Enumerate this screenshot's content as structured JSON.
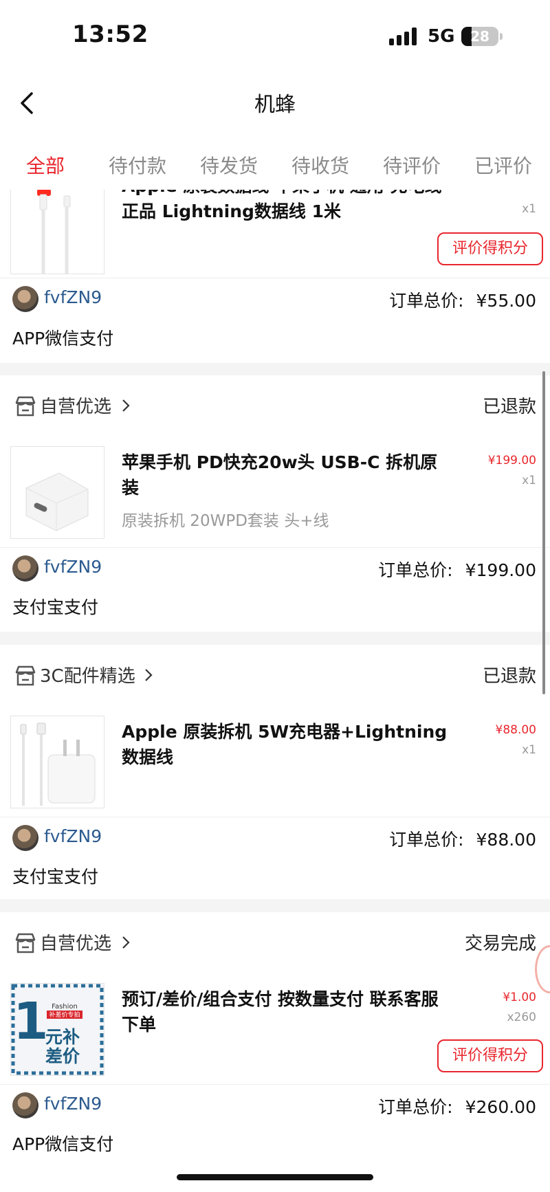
{
  "status_bar": {
    "time": "13:52",
    "network": "5G",
    "battery": "28",
    "battery_level": 0.28
  },
  "nav": {
    "title": "机蜂"
  },
  "tabs": [
    {
      "label": "全部",
      "active": true
    },
    {
      "label": "待付款"
    },
    {
      "label": "待发货"
    },
    {
      "label": "待收货"
    },
    {
      "label": "待评价"
    },
    {
      "label": "已评价"
    }
  ],
  "orders": [
    {
      "title_line1": "Apple 原装数据线 苹果手机 通用 充电线",
      "title_line2": "正品 Lightning数据线 1米",
      "qty": "x1",
      "review_label": "评价得积分",
      "user": "fvfZN9",
      "total_label": "订单总价:",
      "total": "¥55.00",
      "payment": "APP微信支付"
    },
    {
      "shop": "自营优选",
      "status": "已退款",
      "title": "苹果手机 PD快充20w头 USB-C 拆机原装",
      "spec": "原装拆机 20WPD套装 头+线",
      "price": "¥199.00",
      "qty": "x1",
      "user": "fvfZN9",
      "total_label": "订单总价:",
      "total": "¥199.00",
      "payment": "支付宝支付"
    },
    {
      "shop": "3C配件精选",
      "status": "已退款",
      "title": "Apple 原装拆机 5W充电器+Lightning数据线",
      "price": "¥88.00",
      "qty": "x1",
      "user": "fvfZN9",
      "total_label": "订单总价:",
      "total": "¥88.00",
      "payment": "支付宝支付"
    },
    {
      "shop": "自营优选",
      "status": "交易完成",
      "title": "预订/差价/组合支付 按数量支付 联系客服下单",
      "price": "¥1.00",
      "qty": "x260",
      "review_label": "评价得积分",
      "thumb_text": {
        "fashion": "Fashion",
        "tag": "补差价专拍",
        "big": "1",
        "line1": "元补",
        "line2": "差价"
      },
      "user": "fvfZN9",
      "total_label": "订单总价:",
      "total": "¥260.00",
      "payment": "APP微信支付"
    }
  ],
  "colors": {
    "accent": "#e8262d",
    "username": "#2b5a8f",
    "background": "#f4f4f4"
  }
}
